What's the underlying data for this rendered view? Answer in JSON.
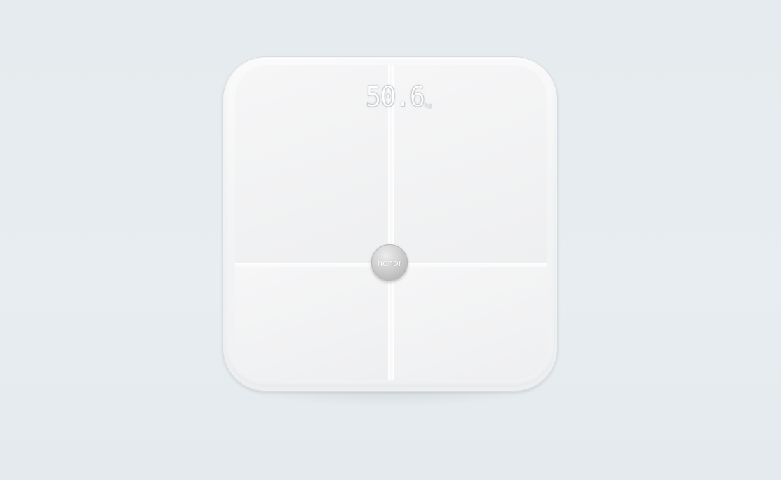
{
  "scene": {
    "background_color": "#e6ecef",
    "object": "smart-body-scale"
  },
  "scale": {
    "display": {
      "value": "50.6",
      "unit": "kg"
    },
    "logo": {
      "text": "honor"
    },
    "colors": {
      "glass": "#f3f4f5",
      "edge": "#d9dde0",
      "button_metal": "#c4c4c4"
    }
  }
}
